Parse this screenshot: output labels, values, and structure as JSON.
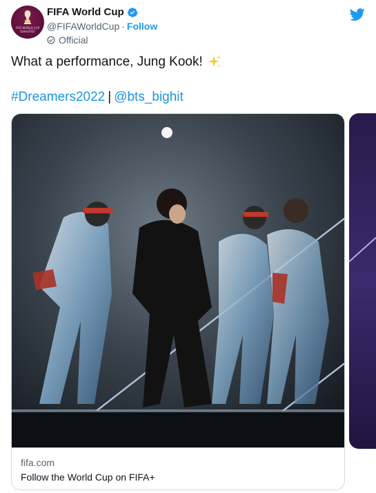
{
  "account": {
    "display_name": "FIFA World Cup",
    "handle": "@FIFAWorldCup",
    "separator": "·",
    "follow_label": "Follow",
    "official_label": "Official",
    "avatar_text": "FIFA WORLD CUP\nQatar2022"
  },
  "tweet": {
    "text": "What a performance, Jung Kook!",
    "emoji": "sparkles",
    "hashtag": "#Dreamers2022",
    "separator": "|",
    "mention": "@bts_bighit"
  },
  "card": {
    "domain": "fifa.com",
    "title": "Follow the World Cup on FIFA+"
  },
  "icons": {
    "verified": "verified-badge-icon",
    "official": "circle-check-icon",
    "brand": "twitter-bird-icon"
  },
  "colors": {
    "link": "#1b95e0",
    "follow": "#1d9bf0",
    "secondary_text": "#536471",
    "border": "#cfd9de",
    "avatar_bg": "#5b0f3a"
  }
}
